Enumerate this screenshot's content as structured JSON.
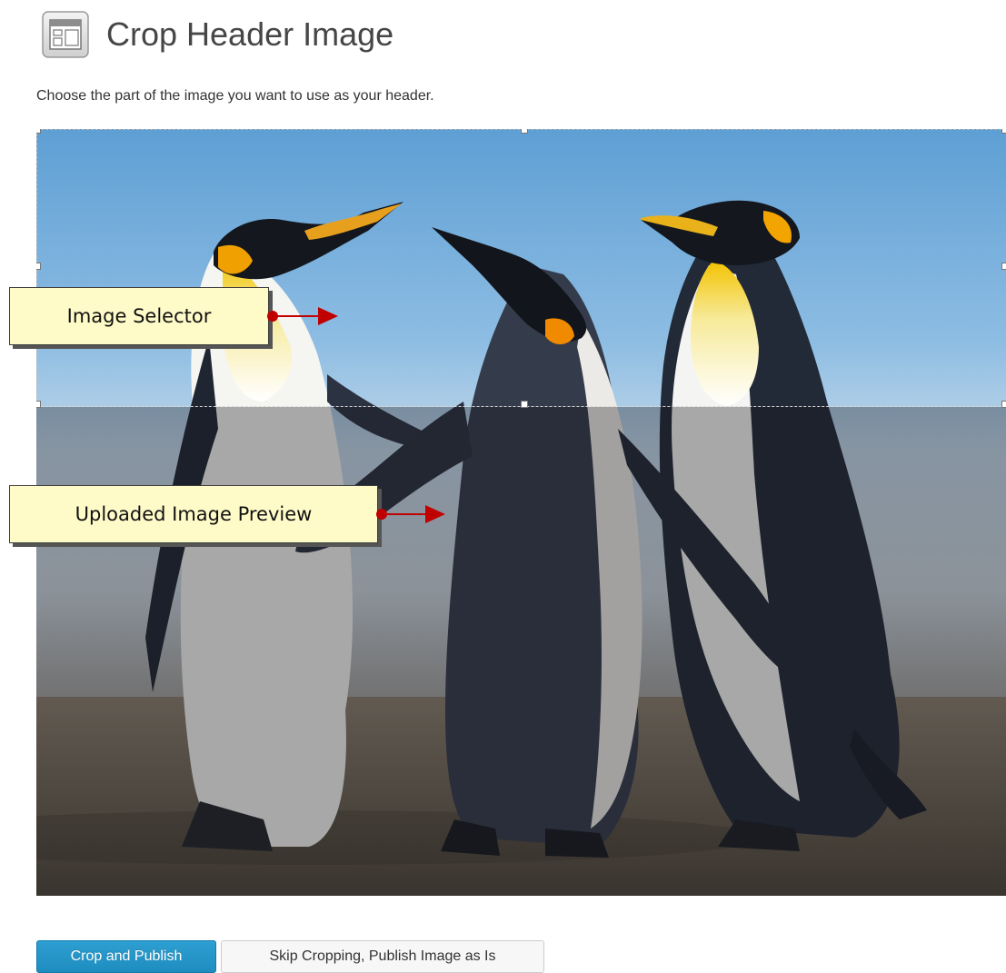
{
  "header": {
    "title": "Crop Header Image",
    "icon": "appearance-header-icon"
  },
  "instructions": "Choose the part of the image you want to use as your header.",
  "crop": {
    "image_description_icon": "uploaded-image-preview",
    "selection_fraction_of_image_height": 0.363
  },
  "annotations": {
    "selector_label": "Image Selector",
    "preview_label": "Uploaded Image Preview",
    "arrow_color": "#c00000"
  },
  "buttons": {
    "crop_publish_label": "Crop and Publish",
    "skip_label": "Skip Cropping, Publish Image as Is"
  },
  "colors": {
    "primary_button": "#1e8cbe",
    "callout_fill": "#fffbc8"
  }
}
